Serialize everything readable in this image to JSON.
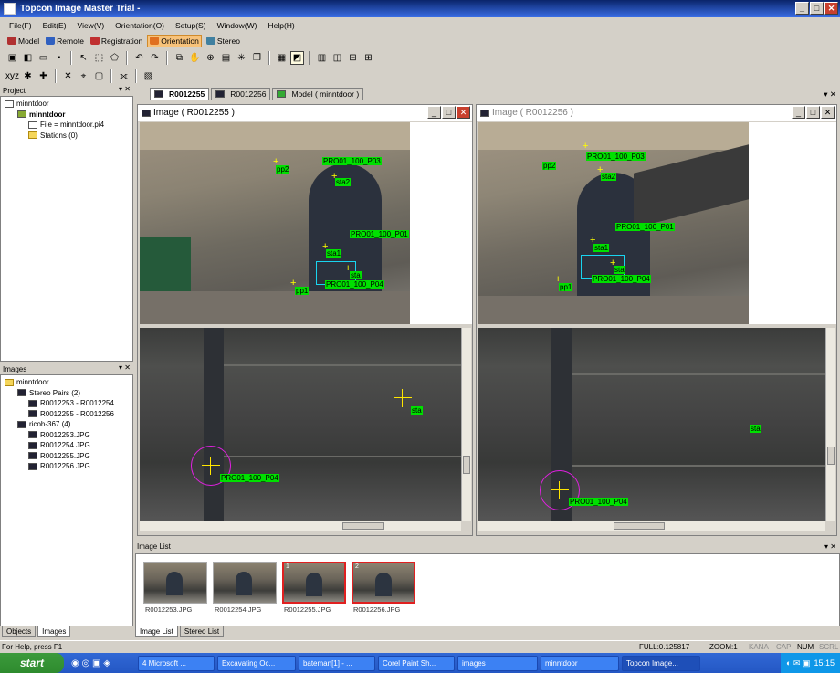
{
  "window": {
    "title": "Topcon Image Master Trial -"
  },
  "menu": [
    "File(F)",
    "Edit(E)",
    "View(V)",
    "Orientation(O)",
    "Setup(S)",
    "Window(W)",
    "Help(H)"
  ],
  "modes": [
    {
      "label": "Model",
      "color": "#b03030",
      "active": false
    },
    {
      "label": "Remote",
      "color": "#3060c0",
      "active": false
    },
    {
      "label": "Registration",
      "color": "#c03030",
      "active": false
    },
    {
      "label": "Orientation",
      "color": "#e07020",
      "active": true
    },
    {
      "label": "Stereo",
      "color": "#4080a0",
      "active": false
    }
  ],
  "project_panel": {
    "title": "Project",
    "items": [
      "minntdoor",
      "minntdoor",
      "File = minntdoor.pi4",
      "Stations (0)"
    ]
  },
  "images_panel": {
    "title": "Images",
    "items": [
      "minntdoor",
      "Stereo Pairs (2)",
      "R0012253 - R0012254",
      "R0012255 - R0012256",
      "ricoh-367 (4)",
      "R0012253.JPG",
      "R0012254.JPG",
      "R0012255.JPG",
      "R0012256.JPG"
    ]
  },
  "left_tabs": [
    "Objects",
    "Images"
  ],
  "doc_tabs": [
    "R0012255",
    "R0012256",
    "Model ( minntdoor )"
  ],
  "image_windows": [
    {
      "title": "Image ( R0012255 )",
      "active": true,
      "labels": [
        "pp2",
        "PRO01_100_P03",
        "sta2",
        "PRO01_100_P01",
        "sta1",
        "pp1",
        "sta",
        "PRO01_100_P04"
      ],
      "zoom_labels": [
        "sta",
        "PRO01_100_P04"
      ]
    },
    {
      "title": "Image ( R0012256 )",
      "active": false,
      "labels": [
        "pp2",
        "PRO01_100_P03",
        "sta2",
        "PRO01_100_P01",
        "sta1",
        "pp1",
        "sta",
        "PRO01_100_P04"
      ],
      "zoom_labels": [
        "sta",
        "PRO01_100_P04"
      ]
    }
  ],
  "image_list": {
    "title": "Image List",
    "items": [
      {
        "name": "R0012253.JPG",
        "selected": false,
        "num": ""
      },
      {
        "name": "R0012254.JPG",
        "selected": false,
        "num": ""
      },
      {
        "name": "R0012255.JPG",
        "selected": true,
        "num": "1"
      },
      {
        "name": "R0012256.JPG",
        "selected": true,
        "num": "2"
      }
    ]
  },
  "bottom_tabs": [
    "Image List",
    "Stereo List"
  ],
  "status": {
    "help": "For Help, press F1",
    "full": "FULL:0.125817",
    "zoom": "ZOOM:1",
    "kana": "KANA",
    "cap": "CAP",
    "num": "NUM",
    "scrl": "SCRL"
  },
  "taskbar": {
    "start": "start",
    "tasks": [
      "4 Microsoft ...",
      "Excavating Oc...",
      "bateman[1] - ...",
      "Corel Paint Sh...",
      "images",
      "minntdoor",
      "Topcon Image..."
    ],
    "clock": "15:15"
  }
}
